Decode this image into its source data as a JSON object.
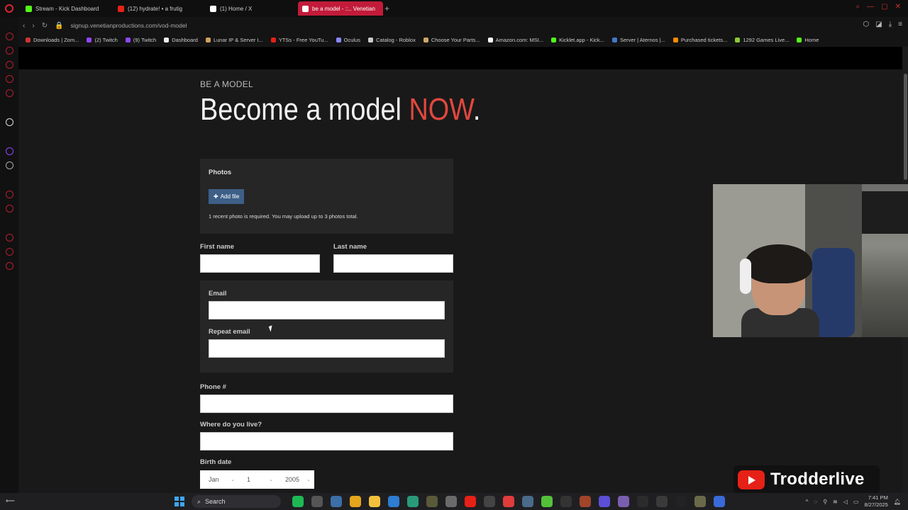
{
  "browser": {
    "tabs": [
      {
        "label": "Stream - Kick Dashboard",
        "color": "#53fc18",
        "active": false
      },
      {
        "label": "(12) hydrate! • a frutig",
        "color": "#e62117",
        "active": false
      },
      {
        "label": "(1) Home / X",
        "color": "#ffffff",
        "active": false
      },
      {
        "label": "be a model - ::.. Venetian",
        "color": "#ffffff",
        "active": true
      }
    ],
    "new_tab": "+",
    "url": "signup.venetianproductions.com/vod-model",
    "bookmarks": [
      {
        "label": "Downloads | Zom...",
        "color": "#cc3333"
      },
      {
        "label": "(2) Twitch",
        "color": "#9146ff"
      },
      {
        "label": "(9) Twitch",
        "color": "#9146ff"
      },
      {
        "label": "Dashboard",
        "color": "#eeeeee"
      },
      {
        "label": "Lunar IP & Server I...",
        "color": "#d0a060"
      },
      {
        "label": "YTSs - Free YouTu...",
        "color": "#e62117"
      },
      {
        "label": "Oculus",
        "color": "#8888ff"
      },
      {
        "label": "Catalog - Roblox",
        "color": "#cccccc"
      },
      {
        "label": "Choose Your Parts...",
        "color": "#ccaa66"
      },
      {
        "label": "Amazon.com: MSI...",
        "color": "#ffffff"
      },
      {
        "label": "Kicklet.app - Kick...",
        "color": "#53fc18"
      },
      {
        "label": "Server | Aternos |...",
        "color": "#4477cc"
      },
      {
        "label": "Purchased tickets...",
        "color": "#ff8800"
      },
      {
        "label": "1292 Games Live...",
        "color": "#88cc33"
      },
      {
        "label": "Home",
        "color": "#53fc18"
      }
    ]
  },
  "page": {
    "kicker": "BE A MODEL",
    "headline_main": "Become a model ",
    "headline_accent": "NOW",
    "headline_end": ".",
    "accent_color": "#e0483e",
    "photos": {
      "title": "Photos",
      "add_file_label": "Add file",
      "note": "1 recent photo is required. You may upload up to 3 photos total."
    },
    "fields": {
      "first_name": "First name",
      "last_name": "Last name",
      "email": "Email",
      "repeat_email": "Repeat email",
      "phone": "Phone #",
      "location": "Where do you live?",
      "birth_date": "Birth date"
    },
    "birth_date": {
      "month": "Jan",
      "day": "1",
      "year": "2005"
    }
  },
  "overlay": {
    "channel_name": "Trodderlive"
  },
  "taskbar": {
    "search_label": "Search",
    "time": "7:41 PM",
    "date": "8/27/2025"
  }
}
